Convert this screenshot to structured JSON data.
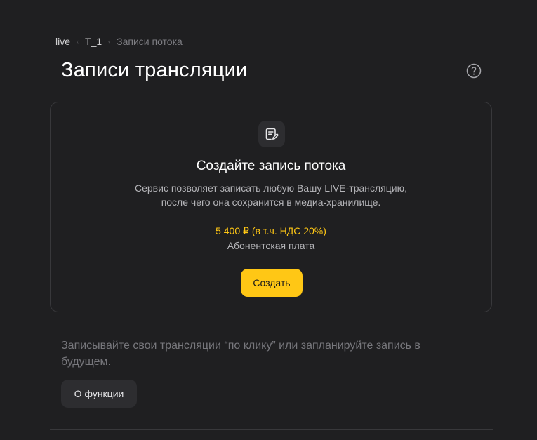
{
  "breadcrumb": {
    "items": [
      {
        "label": "live"
      },
      {
        "label": "T_1"
      },
      {
        "label": "Записи потока"
      }
    ],
    "separator": "‹"
  },
  "header": {
    "title": "Записи трансляции",
    "help_icon": "help-circle-icon"
  },
  "card": {
    "icon": "note-edit-icon",
    "title": "Создайте запись потока",
    "description_line1": "Сервис позволяет записать любую Вашу LIVE-трансляцию,",
    "description_line2": "после чего она сохранится в медиа-хранилище.",
    "price": "5 400 ₽ (в т.ч. НДС 20%)",
    "fee_label": "Абонентская плата",
    "create_label": "Создать"
  },
  "info": {
    "text": "Записывайте свои трансляции “по клику” или запланируйте запись в будущем.",
    "about_label": "О функции"
  },
  "colors": {
    "background": "#1f1f21",
    "accent": "#ffc715",
    "card_border": "#38383b",
    "secondary_button": "#2d2d30"
  }
}
